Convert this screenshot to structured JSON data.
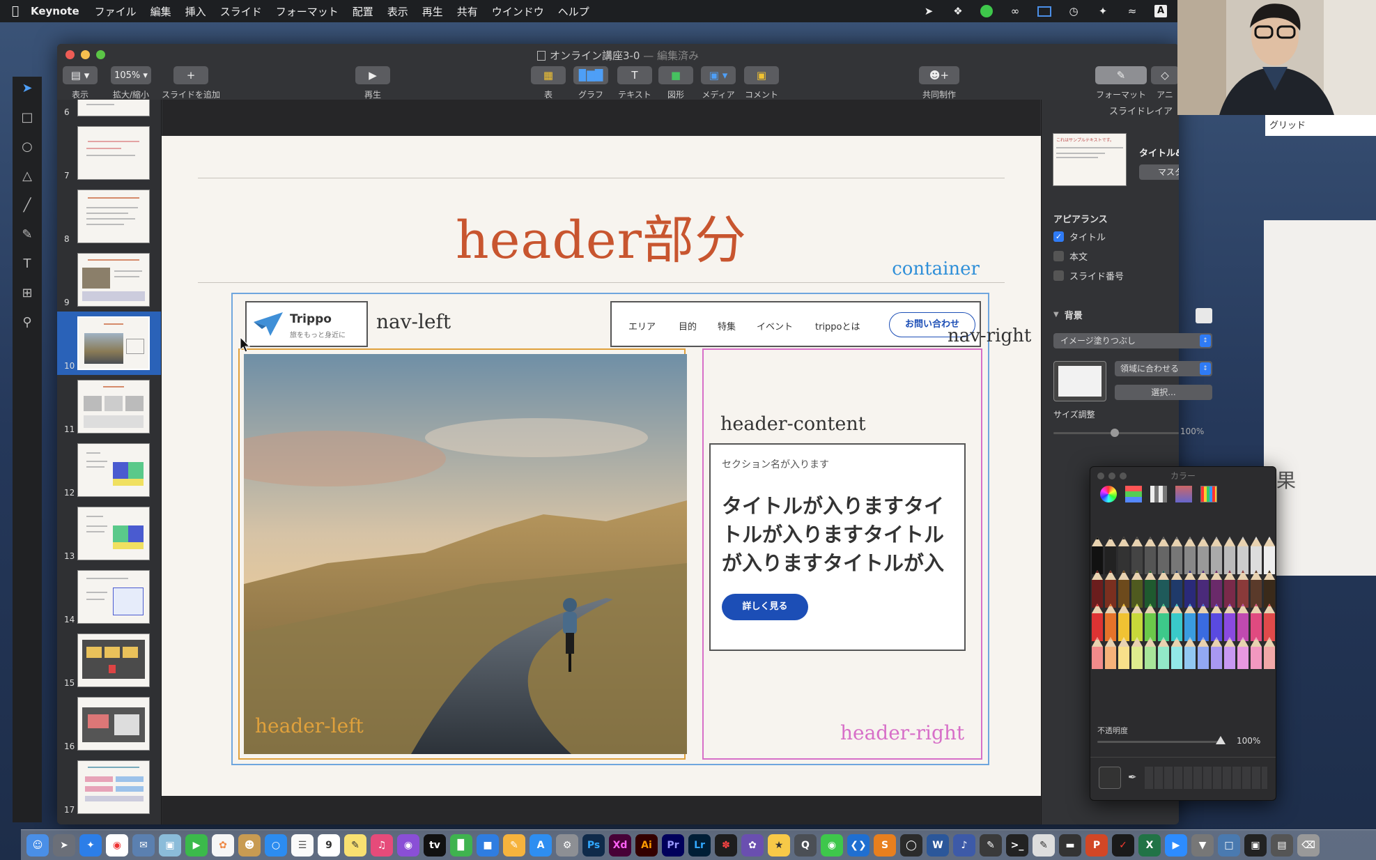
{
  "menubar": {
    "app_name": "Keynote",
    "items": [
      "ファイル",
      "編集",
      "挿入",
      "スライド",
      "フォーマット",
      "配置",
      "表示",
      "再生",
      "共有",
      "ウインドウ",
      "ヘルプ"
    ],
    "status_badge": "A"
  },
  "window": {
    "doc_title": "オンライン講座3-0",
    "doc_status": "— 編集済み"
  },
  "toolbar": {
    "view_label": "表示",
    "zoom_value": "105%",
    "zoom_label": "拡大/縮小",
    "add_slide_label": "スライドを追加",
    "play_label": "再生",
    "table_label": "表",
    "chart_label": "グラフ",
    "text_label": "テキスト",
    "shape_label": "図形",
    "media_label": "メディア",
    "comment_label": "コメント",
    "collab_label": "共同制作",
    "format_label": "フォーマット",
    "animate_label": "アニ"
  },
  "navigator": {
    "slides": [
      {
        "num": "6"
      },
      {
        "num": "7"
      },
      {
        "num": "8"
      },
      {
        "num": "9"
      },
      {
        "num": "10",
        "selected": true
      },
      {
        "num": "11"
      },
      {
        "num": "12"
      },
      {
        "num": "13"
      },
      {
        "num": "14"
      },
      {
        "num": "15"
      },
      {
        "num": "16"
      },
      {
        "num": "17"
      }
    ]
  },
  "slide": {
    "title": "header部分",
    "container_label": "container",
    "logo_name": "Trippo",
    "logo_tagline": "旅をもっと身近に",
    "nav_left_label": "nav-left",
    "nav_right_label": "nav-right",
    "nav_links": [
      "エリア",
      "目的",
      "特集",
      "イベント",
      "trippoとは"
    ],
    "contact_button": "お問い合わせ",
    "header_left_label": "header-left",
    "header_right_label": "header-right",
    "header_content_label": "header-content",
    "section_name": "セクション名が入ります",
    "content_title": "タイトルが入りますタイトルが入りますタイトルが入りますタイトルが入",
    "more_button": "詳しく見る"
  },
  "inspector": {
    "panel_title": "スライドレイア",
    "layout_name": "タイトル&箇条書き",
    "thumb_text": "これはサンプルテキストです。",
    "change_master": "マスターを変更",
    "appearance_heading": "アピアランス",
    "check_title": "タイトル",
    "check_body": "本文",
    "check_slide_number": "スライド番号",
    "background_heading": "背景",
    "fill_type": "イメージ塗りつぶし",
    "scale_mode": "領域に合わせる",
    "choose_button": "選択...",
    "size_label": "サイズ調整",
    "size_value": "100%",
    "grid_label": "グリッド",
    "result_fragment": "果"
  },
  "color_panel": {
    "title": "カラー",
    "opacity_label": "不透明度",
    "opacity_value": "100%"
  },
  "dock": {
    "labels": [
      "Ps",
      "Xd",
      "Ai",
      "Pr",
      "Lr",
      "W",
      "X"
    ]
  },
  "colors": {
    "title_accent": "#c8552f",
    "container_blue": "#2f8fd8",
    "header_left_orange": "#e0a13c",
    "header_right_pink": "#d76fc8",
    "primary_button": "#1c4eb6",
    "selection_blue": "#2a62b8"
  }
}
